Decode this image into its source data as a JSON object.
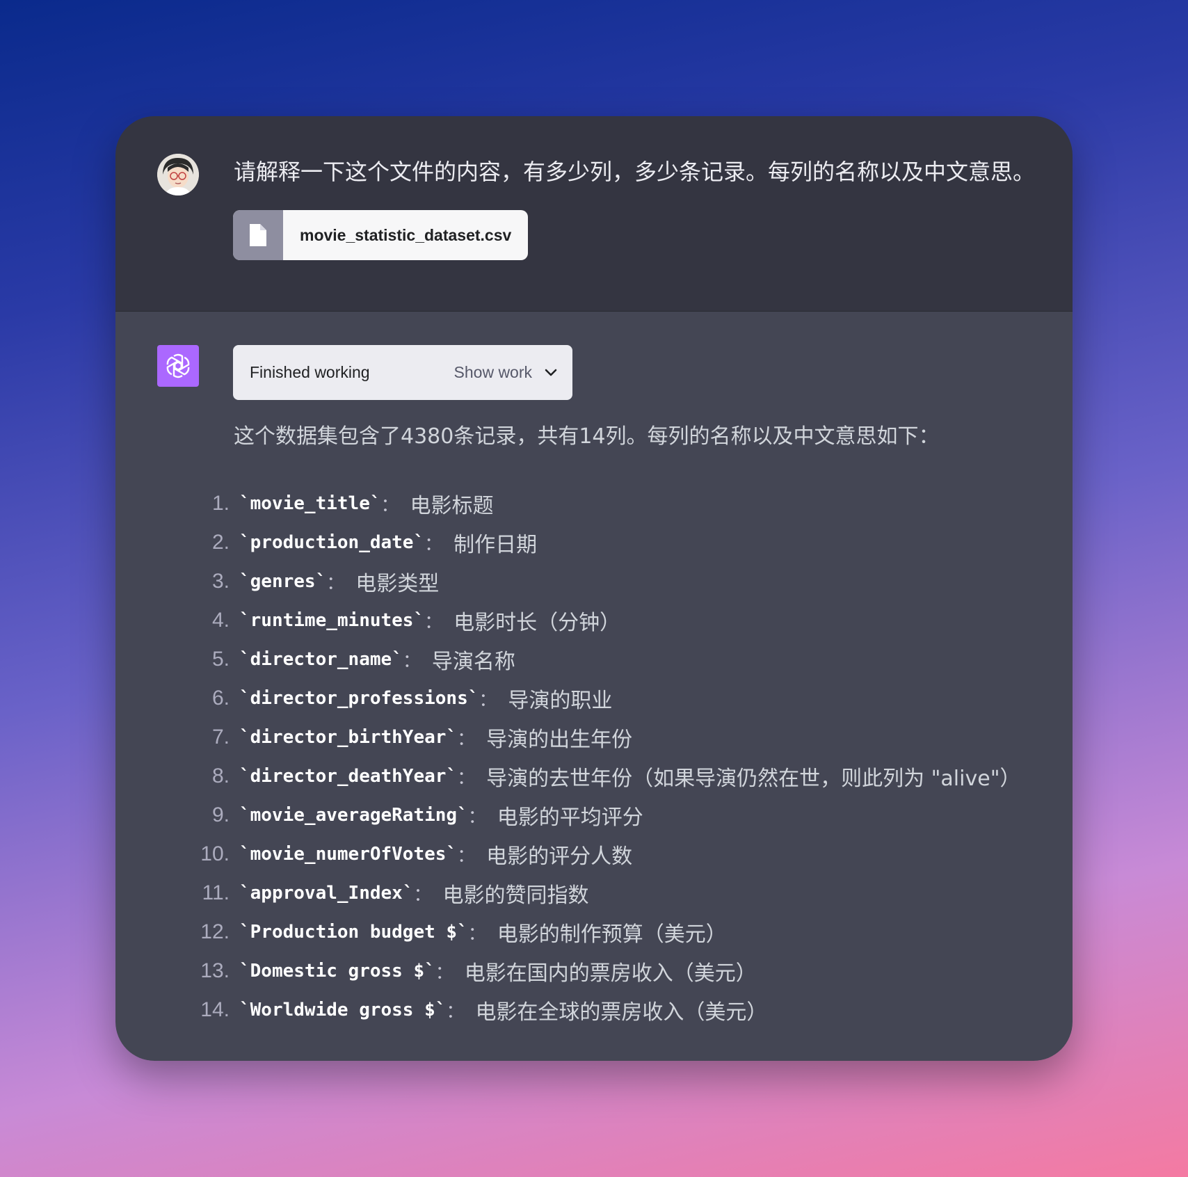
{
  "user_message": {
    "text": "请解释一下这个文件的内容，有多少列，多少条记录。每列的名称以及中文意思。",
    "attachment": {
      "icon": "file-icon",
      "filename": "movie_statistic_dataset.csv"
    }
  },
  "assistant_message": {
    "work_status": "Finished working",
    "show_work_label": "Show work",
    "intro": "这个数据集包含了4380条记录，共有14列。每列的名称以及中文意思如下：",
    "columns": [
      {
        "number": "1.",
        "name": "movie_title",
        "meaning": "电影标题"
      },
      {
        "number": "2.",
        "name": "production_date",
        "meaning": "制作日期"
      },
      {
        "number": "3.",
        "name": "genres",
        "meaning": "电影类型"
      },
      {
        "number": "4.",
        "name": "runtime_minutes",
        "meaning": "电影时长（分钟）"
      },
      {
        "number": "5.",
        "name": "director_name",
        "meaning": "导演名称"
      },
      {
        "number": "6.",
        "name": "director_professions",
        "meaning": "导演的职业"
      },
      {
        "number": "7.",
        "name": "director_birthYear",
        "meaning": "导演的出生年份"
      },
      {
        "number": "8.",
        "name": "director_deathYear",
        "meaning": "导演的去世年份（如果导演仍然在世，则此列为 \"alive\"）"
      },
      {
        "number": "9.",
        "name": "movie_averageRating",
        "meaning": "电影的平均评分"
      },
      {
        "number": "10.",
        "name": "movie_numerOfVotes",
        "meaning": "电影的评分人数"
      },
      {
        "number": "11.",
        "name": "approval_Index",
        "meaning": "电影的赞同指数"
      },
      {
        "number": "12.",
        "name": "Production budget $",
        "meaning": "电影的制作预算（美元）"
      },
      {
        "number": "13.",
        "name": "Domestic gross $",
        "meaning": "电影在国内的票房收入（美元）"
      },
      {
        "number": "14.",
        "name": "Worldwide gross $",
        "meaning": "电影在全球的票房收入（美元）"
      }
    ]
  },
  "colors": {
    "user_bg": "#343541",
    "assistant_bg": "#444654",
    "gpt_logo_bg": "#ab68ff"
  }
}
